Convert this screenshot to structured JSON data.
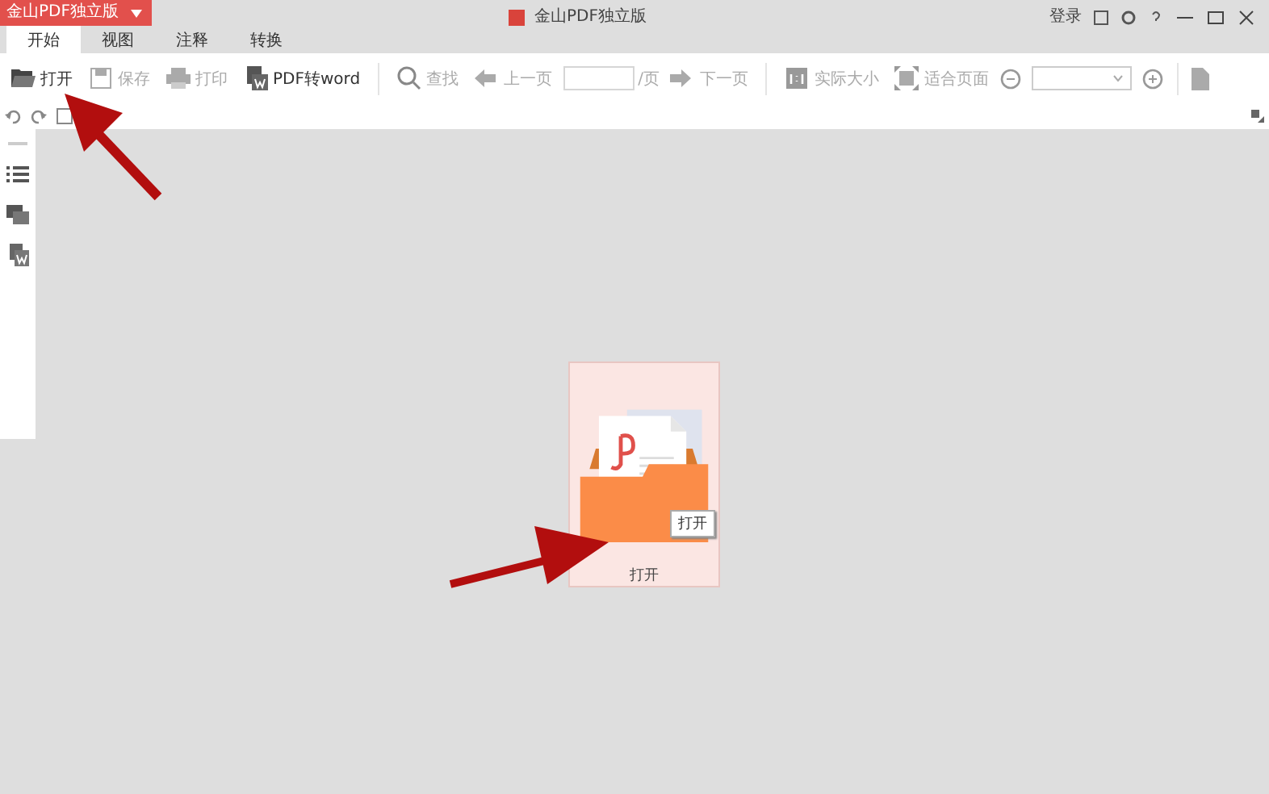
{
  "title_bar": {
    "app_button": "金山PDF独立版",
    "title": "金山PDF独立版",
    "login": "登录"
  },
  "tabs": [
    {
      "label": "开始",
      "selected": true
    },
    {
      "label": "视图",
      "selected": false
    },
    {
      "label": "注释",
      "selected": false
    },
    {
      "label": "转换",
      "selected": false
    }
  ],
  "toolbar": [
    {
      "kind": "button",
      "label": "打开",
      "disabled": false
    },
    {
      "kind": "button",
      "label": "保存",
      "disabled": true
    },
    {
      "kind": "button",
      "label": "打印",
      "disabled": true
    },
    {
      "kind": "button",
      "label": "PDF转word",
      "disabled": false
    },
    {
      "kind": "sep"
    },
    {
      "kind": "button",
      "label": "查找",
      "disabled": true
    },
    {
      "kind": "button",
      "label": "上一页",
      "disabled": true
    },
    {
      "kind": "page",
      "label": "/页"
    },
    {
      "kind": "button",
      "label": "下一页",
      "disabled": true
    },
    {
      "kind": "sep"
    },
    {
      "kind": "button",
      "label": "实际大小",
      "disabled": true
    },
    {
      "kind": "button",
      "label": "适合页面",
      "disabled": true
    },
    {
      "kind": "zoom"
    },
    {
      "kind": "sep"
    }
  ],
  "open_card": {
    "tooltip": "打开",
    "label": "打开"
  }
}
